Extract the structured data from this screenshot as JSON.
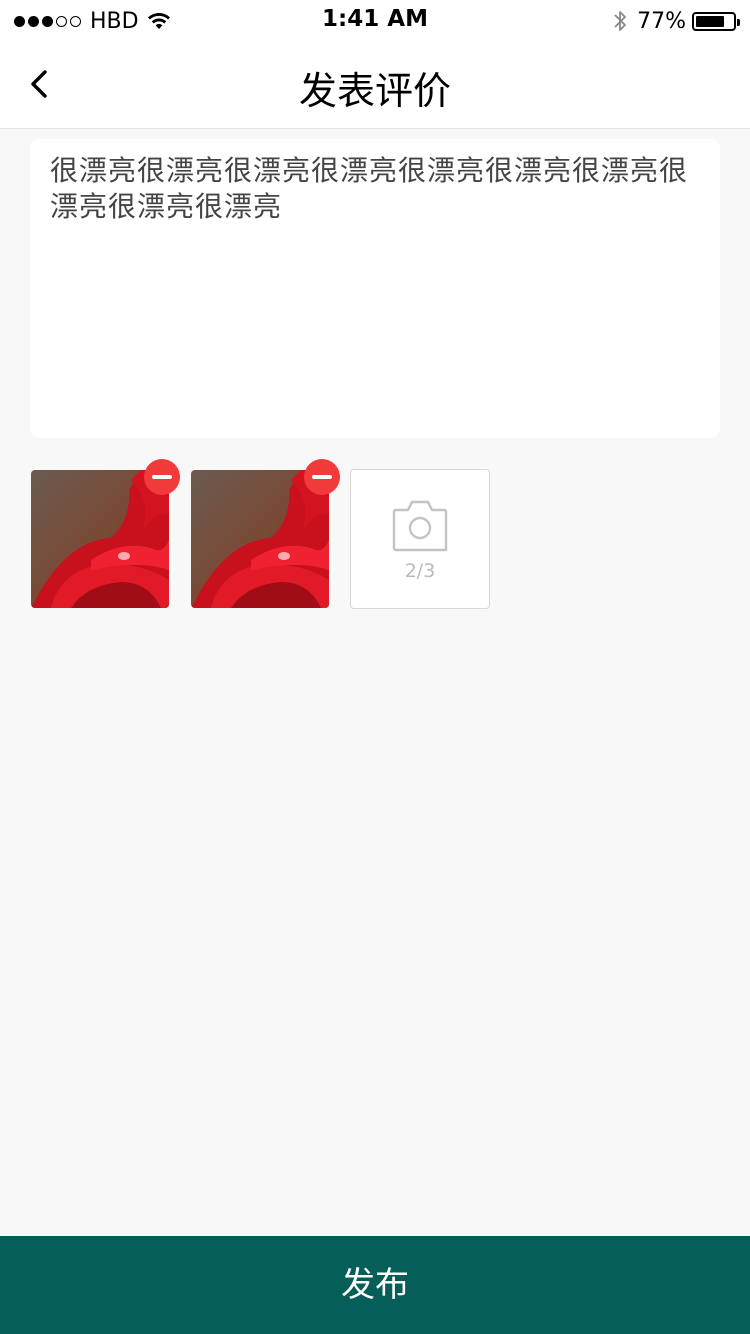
{
  "status_bar": {
    "carrier": "HBD",
    "time": "1:41 AM",
    "battery_percent": "77%",
    "battery_level": 0.77,
    "signal_bars_filled": 3,
    "signal_bars_total": 5
  },
  "nav": {
    "title": "发表评价",
    "back_icon": "chevron-left-icon"
  },
  "review": {
    "text": "很漂亮很漂亮很漂亮很漂亮很漂亮很漂亮很漂亮很漂亮很漂亮很漂亮"
  },
  "photos": {
    "count_label": "2/3",
    "add_icon": "camera-icon",
    "remove_icon": "minus-circle-icon",
    "remove_color": "#f13a3a"
  },
  "footer": {
    "publish_label": "发布",
    "publish_color": "#065e58"
  }
}
